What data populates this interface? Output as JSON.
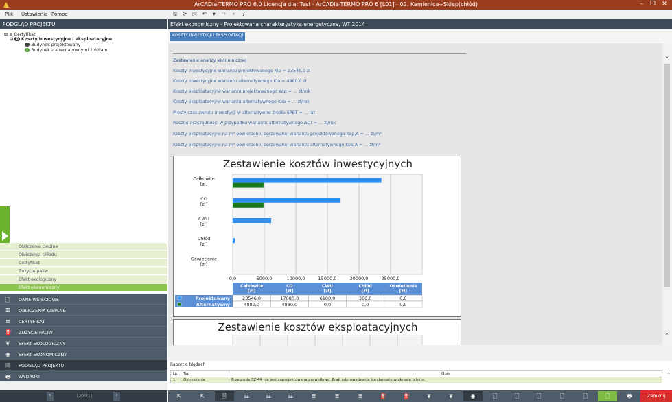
{
  "window": {
    "title": "ArCADia-TERMO PRO 6.0 Licencja dla: Test - ArCADia-TERMO PRO 6 [L01] - 02. Kamienica+Sklep(chłód)"
  },
  "menu": [
    "Plik",
    "Ustawienia",
    "Pomoc"
  ],
  "left_panel": {
    "title": "PODGLĄD PROJEKTU",
    "tree": {
      "root": "Certyfikat",
      "selected": "Koszty inwestycyjne i eksploatacyjne",
      "child1": "Budynek projektowany",
      "child2": "Budynek z alternatywnymi źródłami",
      "badge1": "0",
      "badge2": "1",
      "badge3": "1"
    },
    "sub_items": [
      "Obliczenia cieplne",
      "Obliczenia chłodu",
      "Certyfikat",
      "Zużycie paliw",
      "Efekt ekologiczny",
      "Efekt ekonomiczny"
    ],
    "nav_items": [
      "DANE WEJŚCIOWE",
      "OBLICZENIA CIEPLNE",
      "CERTYFIKAT",
      "ZUŻYCIE PALIW",
      "EFEKT EKOLOGICZNY",
      "EFEKT EKONOMICZNY",
      "PODGLĄD PROJEKTU",
      "WYDRUKI"
    ],
    "pager_text": "[20/21]"
  },
  "main": {
    "title": "Efekt ekonomiczny - Projektowana charakterystyka energetyczna, WT 2014",
    "tab": "KOSZTY INWESTYCJI I EKSPLOATACJI",
    "section_heading": "Zestawienie analizy ekonomicznej",
    "lines": [
      "Koszty inwestycyjne wariantu projektowanego Kip = 23546,0 zł",
      "Koszty inwestycyjne wariantu alternatywnego Kia = 4880,0 zł",
      "Koszty eksploatacyjne wariantu projektowanego Kep = ... zł/rok",
      "Koszty eksploatacyjne wariantu alternatywnego Kea = ... zł/rok",
      "Prosty czas zwrotu inwestycji w alternatywne źródło SPBT = ... lat",
      "Roczne oszczędności w przypadku wariantu alternatywnego ΔOr = ... zł/rok",
      "Koszty eksploatacyjne na m² powierzchni ogrzewanej wariantu projektowanego Kep,A = ... zł/m²",
      "Koszty eksploatacyjne na m² powierzchni ogrzewanej wariantu alternatywnego Kea,A = ... zł/m²"
    ],
    "chart2_title": "Zestawienie kosztów eksploatacyjnych"
  },
  "chart_data": {
    "type": "bar",
    "orientation": "horizontal",
    "title": "Zestawienie kosztów inwestycyjnych",
    "categories": [
      "Całkowite\n[zł]",
      "CO\n[zł]",
      "CWU\n[zł]",
      "Chłód\n[zł]",
      "Oświetlenie\n[zł]"
    ],
    "table_headers": [
      "Całkowite\n[zł]",
      "CO\n[zł]",
      "CWU\n[zł]",
      "Chłód\n[zł]",
      "Oświetlenie\n[zł]"
    ],
    "series": [
      {
        "name": "Projektowany",
        "color": "#2e8ff0",
        "values": [
          23546.0,
          17080.0,
          6100.0,
          366.0,
          0.0
        ],
        "labels": [
          "23546,0",
          "17080,0",
          "6100,0",
          "366,0",
          "0,0"
        ]
      },
      {
        "name": "Alternatywny",
        "color": "#1a7a1a",
        "values": [
          4880.0,
          4880.0,
          0.0,
          0.0,
          0.0
        ],
        "labels": [
          "4880,0",
          "4880,0",
          "0,0",
          "0,0",
          "0,0"
        ]
      }
    ],
    "xlim": [
      0,
      30000
    ],
    "xticks": [
      "0,0",
      "5000,0",
      "10000,0",
      "15000,0",
      "20000,0",
      "25000,0"
    ],
    "grid": true
  },
  "report": {
    "title": "Raport o błędach",
    "headers": [
      "Lp.",
      "Typ",
      "Opis"
    ],
    "rows": [
      [
        "1",
        "Ostrzeżenie",
        "Przegroda SZ-44 nie jest zaprojektowana prawidłowo. Brak odprowadzenia kondensatu w okresie letnim."
      ]
    ]
  },
  "bottom": {
    "close_label": "Zamknij"
  }
}
